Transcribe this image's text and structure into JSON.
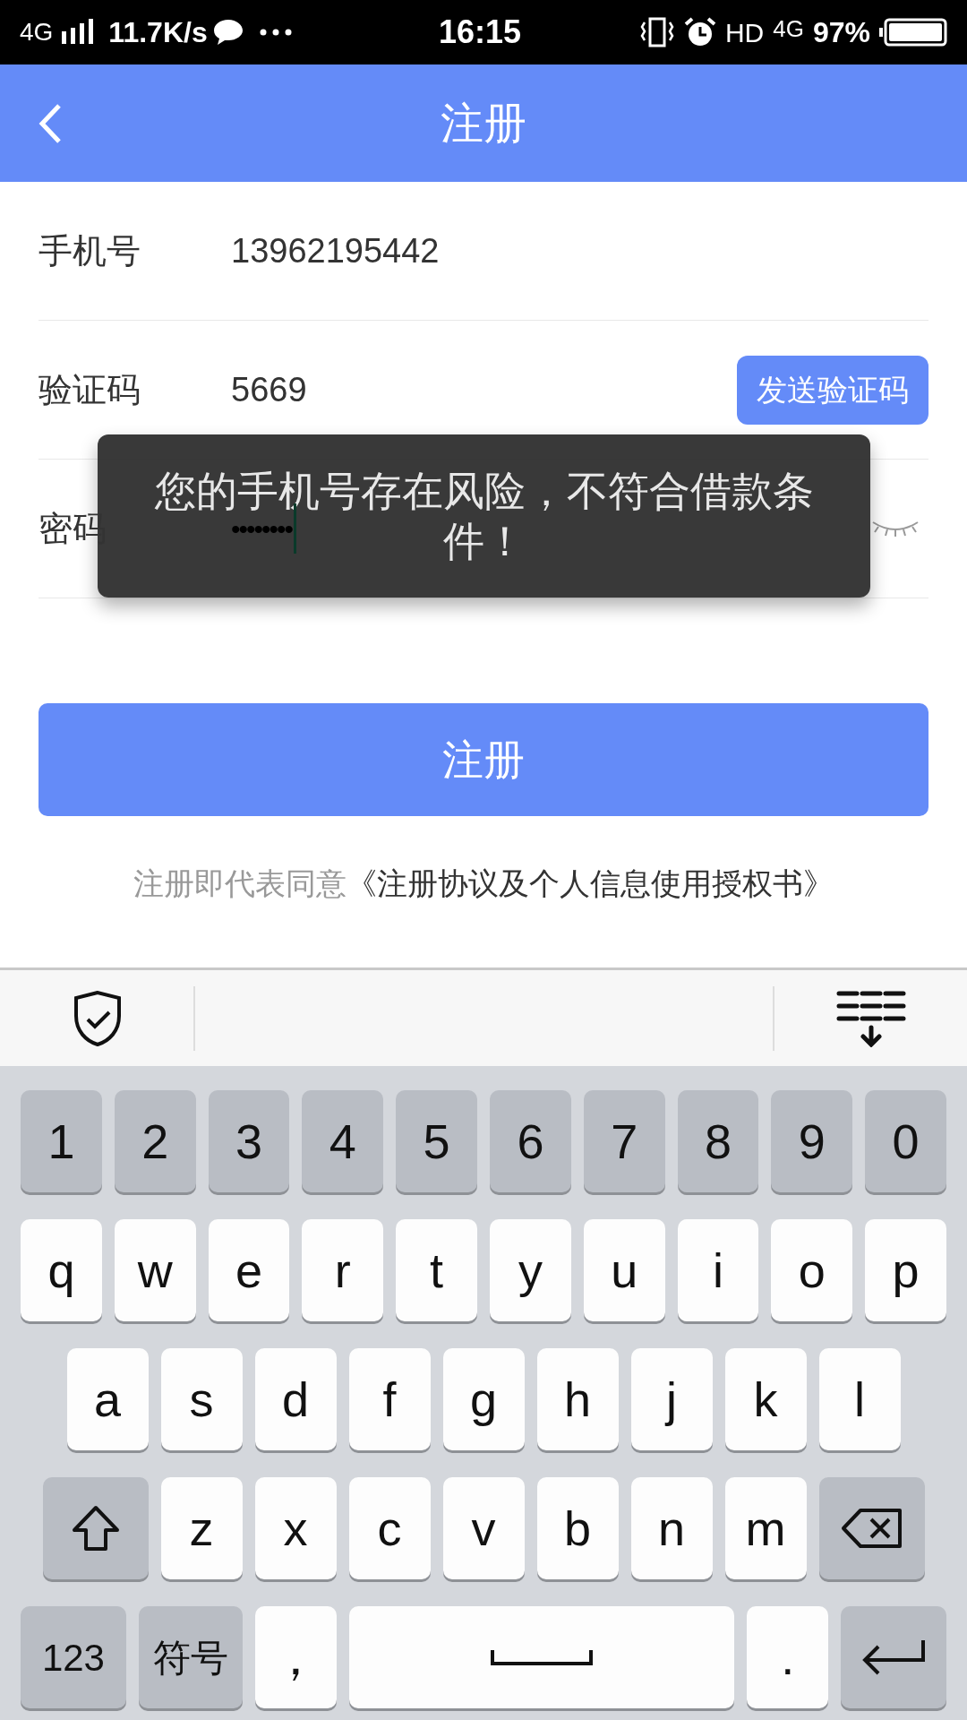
{
  "status_bar": {
    "network": "4G",
    "speed": "11.7K/s",
    "time": "16:15",
    "hd": "HD",
    "data_type": "4G",
    "battery": "97%"
  },
  "header": {
    "title": "注册"
  },
  "form": [
    {
      "label": "手机号",
      "value": "13962195442",
      "kind": "text"
    },
    {
      "label": "验证码",
      "value": "5669",
      "kind": "code",
      "button": "发送验证码"
    },
    {
      "label": "密码",
      "value": "••••••••",
      "kind": "password",
      "focused": true
    }
  ],
  "toast": "您的手机号存在风险，不符合借款条件！",
  "submit": "注册",
  "agreement": {
    "prefix": "注册即代表同意",
    "link": "《注册协议及个人信息使用授权书》"
  },
  "keyboard": [
    [
      {
        "label": "1",
        "kind": "gray"
      },
      {
        "label": "2",
        "kind": "gray"
      },
      {
        "label": "3",
        "kind": "gray"
      },
      {
        "label": "4",
        "kind": "gray"
      },
      {
        "label": "5",
        "kind": "gray"
      },
      {
        "label": "6",
        "kind": "gray"
      },
      {
        "label": "7",
        "kind": "gray"
      },
      {
        "label": "8",
        "kind": "gray"
      },
      {
        "label": "9",
        "kind": "gray"
      },
      {
        "label": "0",
        "kind": "gray"
      }
    ],
    [
      {
        "label": "q",
        "kind": "white"
      },
      {
        "label": "w",
        "kind": "white"
      },
      {
        "label": "e",
        "kind": "white"
      },
      {
        "label": "r",
        "kind": "white"
      },
      {
        "label": "t",
        "kind": "white"
      },
      {
        "label": "y",
        "kind": "white"
      },
      {
        "label": "u",
        "kind": "white"
      },
      {
        "label": "i",
        "kind": "white"
      },
      {
        "label": "o",
        "kind": "white"
      },
      {
        "label": "p",
        "kind": "white"
      }
    ],
    [
      {
        "label": "a",
        "kind": "white"
      },
      {
        "label": "s",
        "kind": "white"
      },
      {
        "label": "d",
        "kind": "white"
      },
      {
        "label": "f",
        "kind": "white"
      },
      {
        "label": "g",
        "kind": "white"
      },
      {
        "label": "h",
        "kind": "white"
      },
      {
        "label": "j",
        "kind": "white"
      },
      {
        "label": "k",
        "kind": "white"
      },
      {
        "label": "l",
        "kind": "white"
      }
    ],
    [
      {
        "kind": "shift"
      },
      {
        "label": "z",
        "kind": "white"
      },
      {
        "label": "x",
        "kind": "white"
      },
      {
        "label": "c",
        "kind": "white"
      },
      {
        "label": "v",
        "kind": "white"
      },
      {
        "label": "b",
        "kind": "white"
      },
      {
        "label": "n",
        "kind": "white"
      },
      {
        "label": "m",
        "kind": "white"
      },
      {
        "kind": "backspace"
      }
    ],
    [
      {
        "label": "123",
        "kind": "mode"
      },
      {
        "label": "符号",
        "kind": "mode"
      },
      {
        "label": "，",
        "kind": "white"
      },
      {
        "kind": "space"
      },
      {
        "label": ".",
        "kind": "white"
      },
      {
        "kind": "enter"
      }
    ]
  ]
}
